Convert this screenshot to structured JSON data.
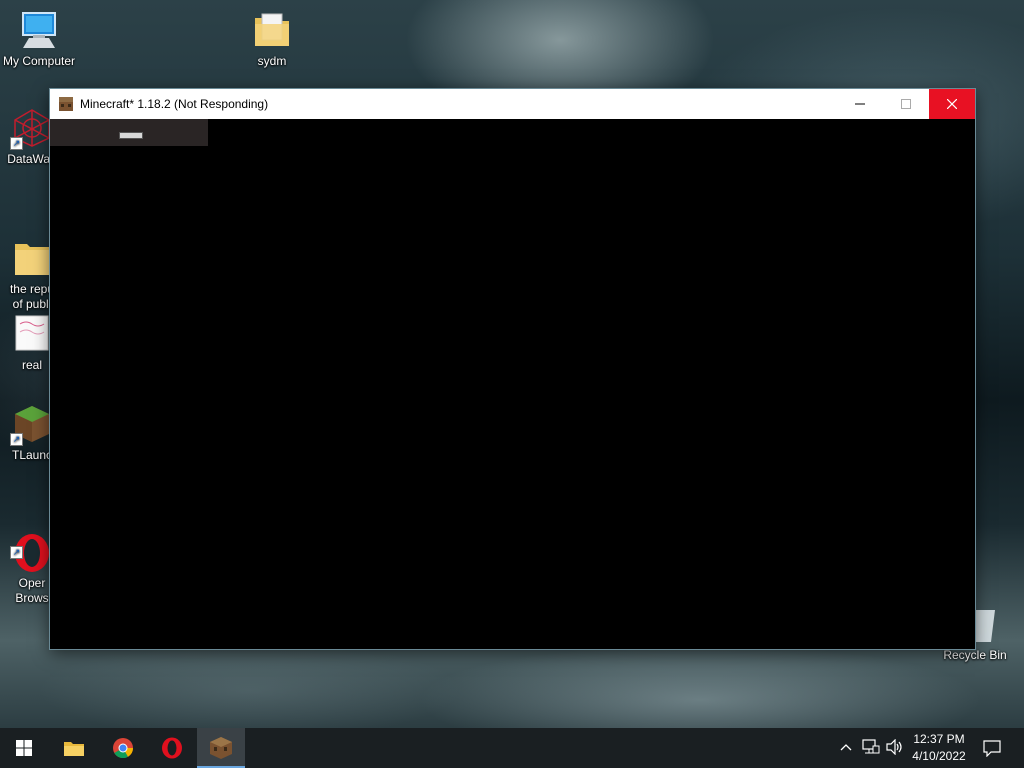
{
  "desktop": {
    "icons": [
      {
        "label": "My Computer",
        "icon": "computer-icon"
      },
      {
        "label": "sydm",
        "icon": "folder-icon"
      },
      {
        "label": "DataWag",
        "icon": "datawag-icon"
      },
      {
        "label": "the repu\nof publi",
        "icon": "folder-icon"
      },
      {
        "label": "real",
        "icon": "image-file-icon"
      },
      {
        "label": "TLaunc",
        "icon": "tlauncher-icon"
      },
      {
        "label": "Oper\nBrows",
        "icon": "opera-icon"
      },
      {
        "label": "Recycle Bin",
        "icon": "recycle-bin-icon"
      }
    ]
  },
  "window": {
    "title": "Minecraft* 1.18.2 (Not Responding)",
    "icon": "minecraft-icon",
    "controls": [
      "minimize",
      "maximize",
      "close"
    ],
    "close_color": "#e81123"
  },
  "taskbar": {
    "items": [
      "start-icon",
      "file-explorer-icon",
      "chrome-icon",
      "opera-icon",
      "minecraft-icon"
    ],
    "active_item": "minecraft-icon",
    "clock": {
      "time": "12:37 PM",
      "date": "4/10/2022"
    }
  }
}
